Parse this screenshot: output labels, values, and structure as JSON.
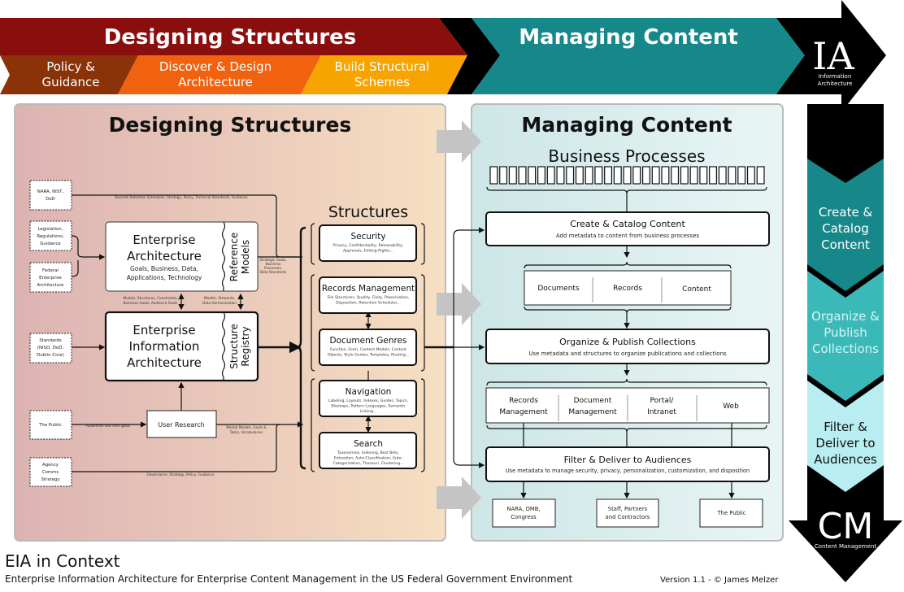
{
  "banner": {
    "designing": "Designing Structures",
    "managing": "Managing Content",
    "phases": [
      {
        "lines": [
          "Policy &",
          "Guidance"
        ],
        "color": "#8a3208"
      },
      {
        "lines": [
          "Discover & Design",
          "Architecture"
        ],
        "color": "#f0620f"
      },
      {
        "lines": [
          "Build Structural",
          "Schemes"
        ],
        "color": "#f7a300"
      }
    ],
    "ia": {
      "abbr": "IA",
      "lines": [
        "Information",
        "Architecture"
      ]
    },
    "colors": {
      "red": "#8b0e0e",
      "teal": "#17888a",
      "black": "#000000"
    }
  },
  "left_panel": {
    "title": "Designing Structures",
    "sources": [
      {
        "lines": [
          "NARA, NIST,",
          "DoD"
        ]
      },
      {
        "lines": [
          "Legislation,",
          "Regulations,",
          "Guidance"
        ]
      },
      {
        "lines": [
          "Federal",
          "Enterprise",
          "Architecture"
        ]
      },
      {
        "lines": [
          "Standards",
          "(NISO, DoD,",
          "Dublin Core)"
        ]
      },
      {
        "lines": [
          "The Public"
        ]
      },
      {
        "lines": [
          "Agency",
          "Comms",
          "Strategy"
        ]
      }
    ],
    "ea": {
      "title": [
        "Enterprise",
        "Architecture"
      ],
      "desc": [
        "Goals, Business, Data,",
        "Applications, Technology"
      ],
      "side": [
        "Reference",
        "Models"
      ]
    },
    "eia": {
      "title": [
        "Enterprise",
        "Information",
        "Architecture"
      ],
      "side": [
        "Structure",
        "Registry"
      ]
    },
    "user_research": "User Research",
    "labels": {
      "nara": "Records Retention Schedules, Strategy, Policy, Technical Standards, Guidance",
      "strategic": [
        "Strategic Goals,",
        "Business",
        "Processes,",
        "Data Standards"
      ],
      "models1": [
        "Models, Structures, Constraints,",
        "Business Goals, Audience Goals"
      ],
      "models2": [
        "Models, Stewards,",
        "Data Harmonization"
      ],
      "audiences": "Audiences and their goals",
      "mental": [
        "Mental Models, Goals &",
        "Tasks, Vocabularies"
      ],
      "governance": "Governance, Strategy, Policy, Guidance"
    },
    "structures": {
      "title": "Structures",
      "items": [
        {
          "title": "Security",
          "desc": [
            "Privacy, Confidentiality, Releasability,",
            "Approvals, Editing Rights..."
          ]
        },
        {
          "title": "Records Management",
          "desc": [
            "File Structures, Quality, Fixity, Preservation,",
            "Disposition, Retention Schedules..."
          ]
        },
        {
          "title": "Document Genres",
          "desc": [
            "Function, Form, Content Models, Content",
            "Objects, Style Guides, Templates, Routing..."
          ]
        },
        {
          "title": "Navigation",
          "desc": [
            "Labeling, Layouts, Indexes, Guides, Topics,",
            "Sitemaps, Pattern Languages, Semantic",
            "Linking..."
          ]
        },
        {
          "title": "Search",
          "desc": [
            "Taxonomies, Indexing, Best Bets,",
            "Extraction, Auto-Classification, Auto-",
            "Categorization, Thesauri, Clustering..."
          ]
        }
      ]
    }
  },
  "right_panel": {
    "title": "Managing Content",
    "business_processes": "Business Processes",
    "create": {
      "title": "Create & Catalog Content",
      "desc": "Add metadata to content from business processes"
    },
    "content_types": [
      "Documents",
      "Records",
      "Content"
    ],
    "organize": {
      "title": "Organize & Publish Collections",
      "desc": "Use metadata and structures to organize publications and collections"
    },
    "systems": [
      [
        "Records",
        "Management"
      ],
      [
        "Document",
        "Management"
      ],
      [
        "Portal/",
        "Intranet"
      ],
      [
        "Web"
      ]
    ],
    "filter": {
      "title": "Filter & Deliver to Audiences",
      "desc": "Use metadata to manage security, privacy, personalization, customization, and disposition"
    },
    "audiences": [
      [
        "NARA, OMB,",
        "Congress"
      ],
      [
        "Staff, Partners",
        "and Contractors"
      ],
      [
        "The Public"
      ]
    ]
  },
  "side_column": {
    "stages": [
      {
        "lines": [
          "Create &",
          "Catalog",
          "Content"
        ],
        "color": "#17888a"
      },
      {
        "lines": [
          "Organize &",
          "Publish",
          "Collections"
        ],
        "color": "#3bb9b9"
      },
      {
        "lines": [
          "Filter &",
          "Deliver to",
          "Audiences"
        ],
        "color": "#b8eef2"
      }
    ],
    "cm": {
      "abbr": "CM",
      "label": "Content Management"
    }
  },
  "footer": {
    "title": "EIA in Context",
    "subtitle": "Enterprise Information Architecture for Enterprise Content Management in the US Federal Government Environment",
    "version": "Version 1.1 - © James Melzer"
  }
}
